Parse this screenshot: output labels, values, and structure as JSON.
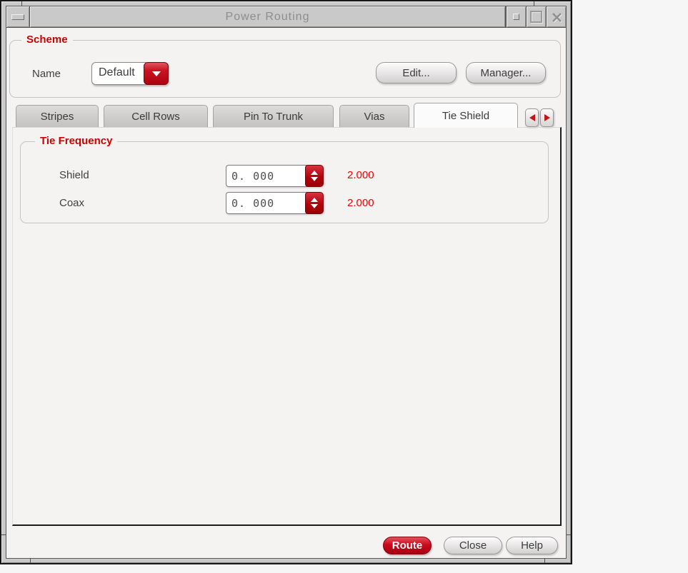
{
  "window": {
    "title": "Power Routing",
    "titlebar_icons": {
      "menu": "dash-icon",
      "iconify": "small-square-icon",
      "maximize": "square-outline-icon",
      "close": "x-icon"
    }
  },
  "scheme": {
    "group_label": "Scheme",
    "name_label": "Name",
    "name_value": "Default",
    "edit_button": "Edit...",
    "manager_button": "Manager..."
  },
  "tabs": {
    "items": [
      {
        "label": "Stripes",
        "active": false
      },
      {
        "label": "Cell Rows",
        "active": false
      },
      {
        "label": "Pin To Trunk",
        "active": false
      },
      {
        "label": "Vias",
        "active": false
      },
      {
        "label": "Tie Shield",
        "active": true
      }
    ],
    "prev_icon": "left-triangle",
    "next_icon": "right-triangle"
  },
  "tie_frequency": {
    "group_label": "Tie Frequency",
    "rows": [
      {
        "label": "Shield",
        "value": "0. 000",
        "limit": "2.000"
      },
      {
        "label": "Coax",
        "value": "0. 000",
        "limit": "2.000"
      }
    ]
  },
  "footer": {
    "route_button": "Route",
    "close_button": "Close",
    "help_button": "Help"
  },
  "colors": {
    "accent_red": "#cc0000",
    "value_red": "#ee0000",
    "control_red": "#b5000e",
    "titlebar_gray": "#c9c9c9",
    "content_bg": "#f5f2f2"
  }
}
